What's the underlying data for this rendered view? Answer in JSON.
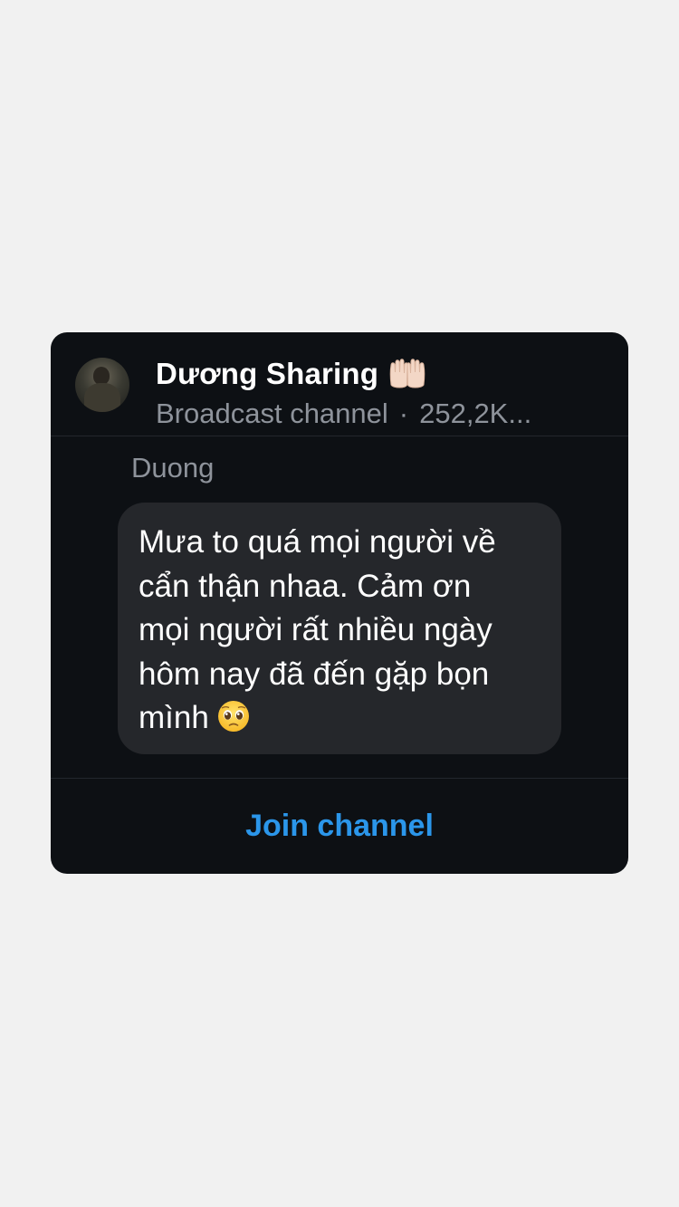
{
  "channel": {
    "name": "Dương Sharing",
    "type_label": "Broadcast channel",
    "separator": "·",
    "followers": "252,2K..."
  },
  "message": {
    "sender": "Duong",
    "lines": [
      "Mưa to quá mọi người về",
      "cẩn thận nhaa. Cảm ơn",
      "mọi người rất nhiều ngày",
      "hôm nay đã đến gặp bọn",
      "mình"
    ]
  },
  "actions": {
    "join_label": "Join channel"
  },
  "icons": {
    "name_emoji": "raised-palms-icon",
    "message_emoji": "pleading-face-icon"
  },
  "colors": {
    "page_background": "#f1f1f1",
    "card_background": "#0d1014",
    "bubble_background": "#25272b",
    "accent": "#2b96ea",
    "secondary_text": "#8e939b"
  }
}
